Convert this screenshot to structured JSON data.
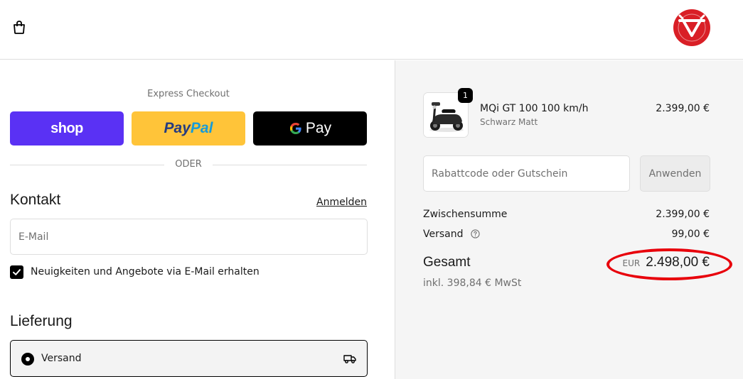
{
  "header": {
    "cart_icon": "shopping-bag-icon",
    "logo_icon": "brand-logo"
  },
  "express_checkout": {
    "title": "Express Checkout",
    "shop_label": "shop",
    "paypal_label_a": "Pay",
    "paypal_label_b": "Pal",
    "gpay_label": "Pay",
    "divider_text": "ODER"
  },
  "contact": {
    "title": "Kontakt",
    "login_link": "Anmelden",
    "email_placeholder": "E-Mail",
    "email_value": "",
    "newsletter_label": "Neuigkeiten und Angebote via E-Mail erhalten",
    "newsletter_checked": true
  },
  "delivery": {
    "title": "Lieferung",
    "option_label": "Versand",
    "option_icon": "truck-icon",
    "option_selected": true
  },
  "order": {
    "item": {
      "quantity": "1",
      "name": "MQi GT 100 100 km/h",
      "variant": "Schwarz Matt",
      "price": "2.399,00 €"
    },
    "discount_placeholder": "Rabattcode oder Gutschein",
    "apply_label": "Anwenden",
    "subtotal_label": "Zwischensumme",
    "subtotal_value": "2.399,00 €",
    "shipping_label": "Versand",
    "shipping_value": "99,00 €",
    "total_label": "Gesamt",
    "total_currency": "EUR",
    "total_value": "2.498,00 €",
    "tax_note": "inkl. 398,84 € MwSt"
  },
  "colors": {
    "shop_purple": "#5a31f4",
    "paypal_yellow": "#ffc439",
    "gpay_black": "#000000",
    "summary_bg": "#f5f5f5",
    "highlight_red": "#e8000b",
    "logo_red": "#d91f26"
  }
}
